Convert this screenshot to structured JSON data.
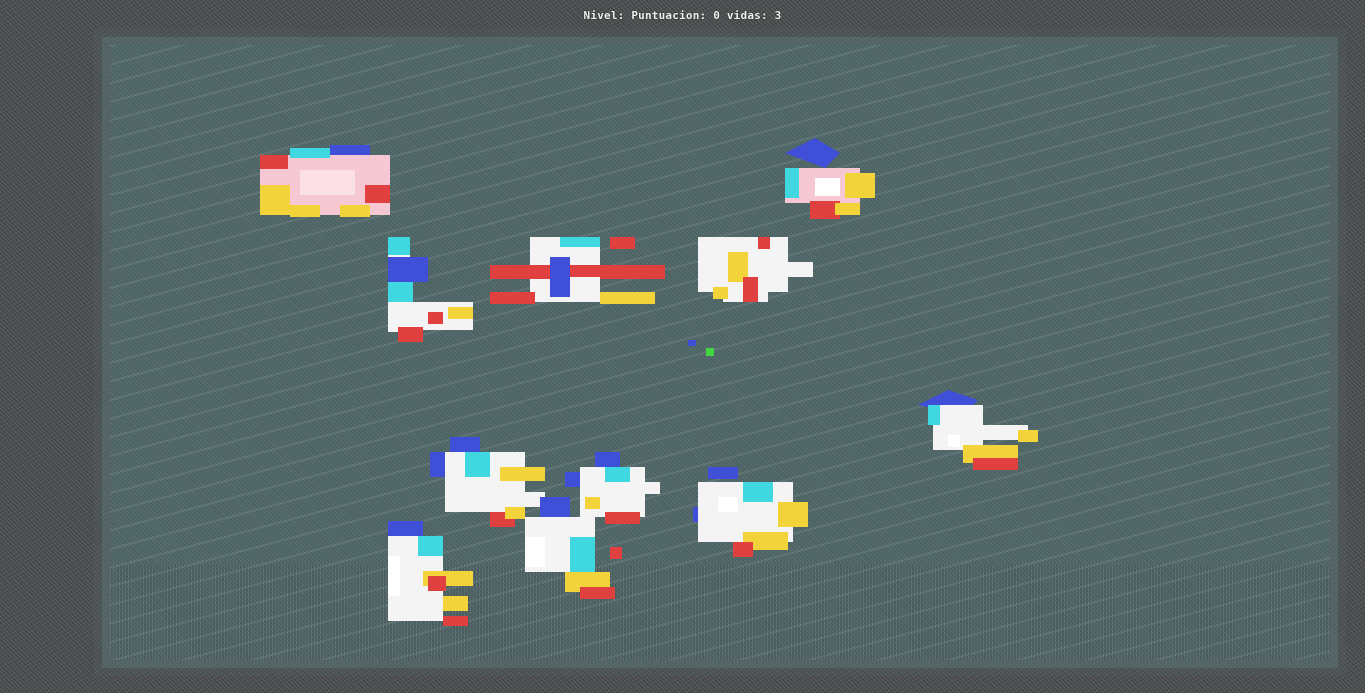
{
  "hud": {
    "nivel_label": "Nivel:",
    "puntuacion_label": "Puntuacion:",
    "puntuacion_value": "0",
    "vidas_label": "vidas:",
    "vidas_value": "3"
  },
  "colors": {
    "board": "#587071",
    "background": "#4d5051",
    "sprite_white": "#f4f4f4",
    "sprite_red": "#e04040",
    "sprite_yellow": "#f2d43a",
    "sprite_cyan": "#3fd8e0",
    "sprite_blue": "#3f4fd8",
    "sprite_pink": "#f6c8d4"
  },
  "sprites": [
    {
      "name": "pink-car-enemy",
      "icon": "car-sprite"
    },
    {
      "name": "bird-enemy-top",
      "icon": "bird-sprite"
    },
    {
      "name": "letter-l-block",
      "icon": "letter-block-sprite"
    },
    {
      "name": "letter-e-block",
      "icon": "letter-block-sprite"
    },
    {
      "name": "letter-y-block",
      "icon": "letter-block-sprite"
    },
    {
      "name": "player-ship",
      "icon": "ship-sprite"
    },
    {
      "name": "bird-enemy-right",
      "icon": "bird-sprite"
    },
    {
      "name": "bird-enemy-cluster-1",
      "icon": "bird-sprite"
    },
    {
      "name": "bird-enemy-cluster-2",
      "icon": "bird-sprite"
    },
    {
      "name": "bird-enemy-cluster-3",
      "icon": "bird-sprite"
    },
    {
      "name": "bird-enemy-cluster-4",
      "icon": "bird-sprite"
    },
    {
      "name": "bird-enemy-low",
      "icon": "bird-sprite"
    }
  ]
}
